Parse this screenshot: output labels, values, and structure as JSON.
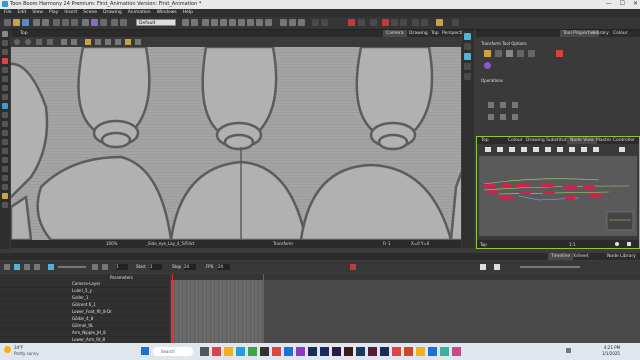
{
  "window": {
    "title": "Toon Boom Harmony 24 Premium: First_Animation Version: First_Animation *",
    "min": "—",
    "max": "☐",
    "close": "✕"
  },
  "menu": [
    "File",
    "Edit",
    "View",
    "Play",
    "Insert",
    "Scene",
    "Drawing",
    "Animation",
    "Windows",
    "Help"
  ],
  "toolbar": {
    "preset": "Default"
  },
  "view_tabs": {
    "main": "Top",
    "tabs": [
      "Camera",
      "Drawing",
      "Top",
      "Perspective"
    ]
  },
  "view_status": {
    "zoom": "100%",
    "drawing_path": "_Side_eye_Lay_4_5/Fillct",
    "tool": "Transform",
    "frame": "Fr 1",
    "coords": "X=0   Y=0"
  },
  "tool_properties": {
    "tabs": [
      "Tool Properties",
      "Library",
      "Colour"
    ],
    "section": "Transform Tool Options",
    "operations": "Operations"
  },
  "node_view": {
    "tabs": [
      "Top",
      "Colour",
      "Drawing Substitutions",
      "Node View",
      "Master Controller"
    ],
    "footer_left": "Top",
    "footer_right": "1:1"
  },
  "timeline": {
    "tabs": [
      "Timeline",
      "Xsheet",
      "Node Library"
    ],
    "start_label": "Start",
    "start": "1",
    "stop_label": "Stop",
    "stop": "24",
    "fps_label": "FPS",
    "fps": "24",
    "current_frame": "1",
    "col_header": "Parameters",
    "layers": [
      "Camera-Layer",
      "Luleri_5_y",
      "Goller_1",
      "Gölcent 6_1",
      "Lower_Foot_Rt_8-Dr",
      "Gödar_4_8",
      "Gölrnel_9L",
      "Arm_Nipple_JH_8",
      "Lower_Arm_Rt_8"
    ]
  },
  "taskbar": {
    "weather_temp": "34°F",
    "weather_desc": "Partly sunny",
    "search_placeholder": "Search",
    "time": "4:21 PM",
    "date": "1/1/2025"
  }
}
